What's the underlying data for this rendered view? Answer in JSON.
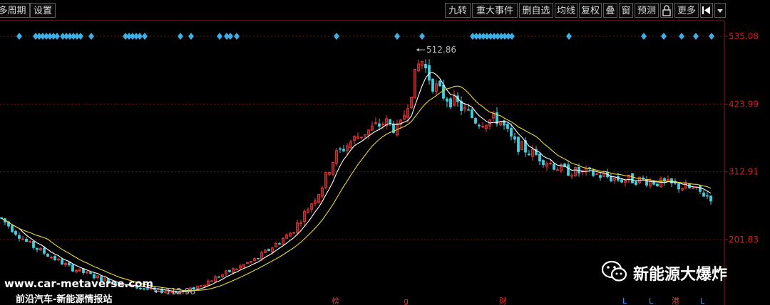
{
  "toolbar": {
    "left_items": [
      "多周期",
      "设置"
    ],
    "right_items": [
      "九转",
      "重大事件",
      "删自选",
      "均线",
      "复权",
      "叠",
      "窗",
      "预测",
      "更多"
    ],
    "lock_icon": "lock-icon",
    "pin_icon": "pin-icon",
    "dropdown_icon": "chevron-down-icon"
  },
  "price_axis": {
    "labels": [
      "535.08",
      "423.99",
      "312.91",
      "201.83"
    ]
  },
  "extremes": {
    "high": "512.86",
    "low": "112.96"
  },
  "bottom_markers": [
    {
      "text": "榜",
      "color": "#dd3333"
    },
    {
      "text": "g",
      "color": "#dd3333"
    },
    {
      "text": "财",
      "color": "#dd3333"
    },
    {
      "text": "L",
      "color": "#3399ff"
    },
    {
      "text": "L",
      "color": "#3399ff"
    },
    {
      "text": "港",
      "color": "#dd3333"
    },
    {
      "text": "L",
      "color": "#3399ff"
    }
  ],
  "watermark": {
    "url": "www.car-metaverse.com",
    "site": "前沿汽车-新能源情报站",
    "wechat_name": "新能源大爆炸"
  },
  "colors": {
    "up": "#ff3b3b",
    "down": "#3fd0e0",
    "ma_short": "#ffffff",
    "ma_long": "#e8d83a",
    "event_diamond": "#3cb0e6",
    "grid": "#7a1010"
  },
  "chart_data": {
    "type": "candlestick",
    "y_axis_ticks": [
      535.08,
      423.99,
      312.91,
      201.83
    ],
    "high_marker": 512.86,
    "low_marker": 112.96,
    "series": [
      {
        "name": "",
        "type": "line",
        "color": "#ffffff"
      },
      {
        "name": "",
        "type": "line",
        "color": "#e8d83a"
      }
    ]
  }
}
